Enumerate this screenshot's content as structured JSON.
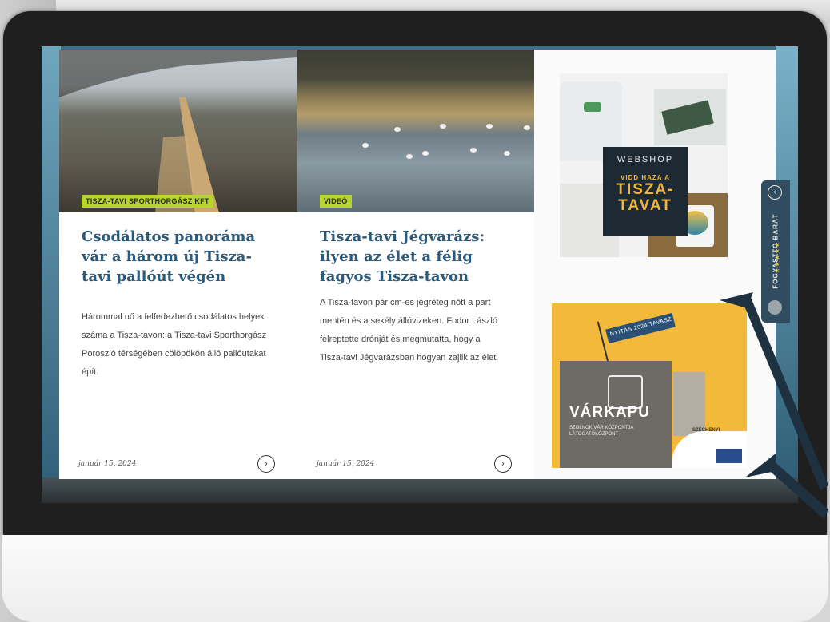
{
  "cards": [
    {
      "category": "TISZA-TAVI SPORTHORGÁSZ KFT",
      "title": "Csodálatos panoráma vár a három új Tisza-tavi pallóút végén",
      "excerpt": "Hárommal nő a felfedezhető csodálatos helyek száma a Tisza-tavon: a Tisza-tavi Sporthorgász Poroszló térségében cölöpökön álló pallóutakat épít.",
      "date": "január 15, 2024"
    },
    {
      "category": "VIDEÓ",
      "title": "Tisza-tavi Jégvarázs: ilyen az élet a félig fagyos Tisza-tavon",
      "excerpt": "A Tisza-tavon pár cm-es jégréteg nőtt a part mentén és a sekély állóvizeken. Fodor László felreptette drónját és megmutatta, hogy a Tisza-tavi Jégvarázsban hogyan zajlik az élet.",
      "date": "január 15, 2024"
    }
  ],
  "sidebar": {
    "webshop": {
      "title": "WEBSHOP",
      "subtitle": "VIDD HAZA A",
      "headline_1": "TISZA-",
      "headline_2": "TAVAT"
    },
    "varkapu": {
      "flag": "NYITÁS 2024 TAVASZ",
      "name": "VÁRKAPU",
      "tagline": "SZOLNOK VÁR KÖZPONTJA LÁTOGATÓKÖZPONT",
      "sponsor": "SZÉCHENYI"
    }
  },
  "friend_badge": {
    "label": "FOGYASZTÓ BARÁT",
    "stars": "★★★★★"
  },
  "colors": {
    "category_tag": "#b7d430",
    "title": "#2c5a7a",
    "webshop_accent": "#f4b43b",
    "varkapu_bg": "#f2b93a"
  }
}
